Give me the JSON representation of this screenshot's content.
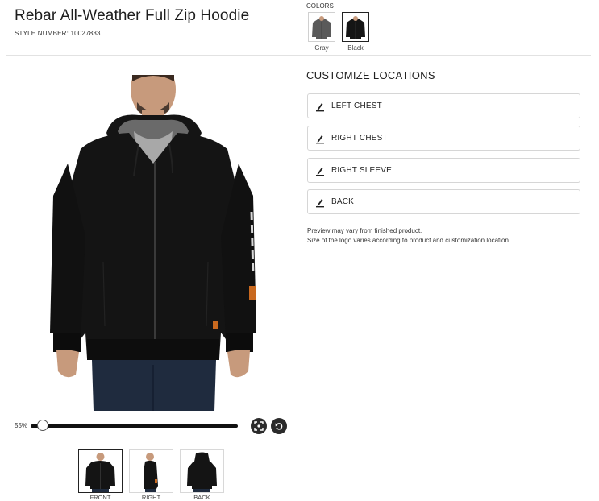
{
  "product": {
    "title": "Rebar All-Weather Full Zip Hoodie",
    "style_number": "STYLE NUMBER: 10027833"
  },
  "colors": {
    "label": "COLORS",
    "options": [
      {
        "name": "Gray",
        "hex": "#5a5a5a",
        "selected": false
      },
      {
        "name": "Black",
        "hex": "#151515",
        "selected": true
      }
    ]
  },
  "preview": {
    "zoom_label": "55%",
    "zoom_percent": 55,
    "views": [
      {
        "label": "FRONT",
        "selected": true
      },
      {
        "label": "RIGHT",
        "selected": false
      },
      {
        "label": "BACK",
        "selected": false
      }
    ]
  },
  "customize": {
    "title": "CUSTOMIZE LOCATIONS",
    "locations": [
      "LEFT CHEST",
      "RIGHT CHEST",
      "RIGHT SLEEVE",
      "BACK"
    ],
    "notes": [
      "Preview may vary from finished product.",
      "Size of the logo varies according to product and customization location."
    ]
  },
  "icons": {
    "location": "pen-icon",
    "fit": "fit-screen-icon",
    "reset": "undo-icon"
  },
  "palette": {
    "garment": "#141414",
    "hood_lining": "#6a6a6a",
    "skin": "#c79a7c",
    "jeans": "#1f2b3e",
    "accent": "#c9691f"
  }
}
